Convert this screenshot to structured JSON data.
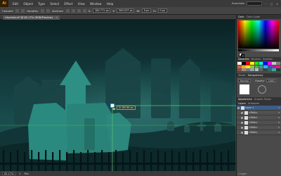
{
  "menubar": {
    "app_logo": "Ai",
    "items": [
      "Edit",
      "Object",
      "Type",
      "Select",
      "Effect",
      "View",
      "Window",
      "Help"
    ],
    "workspace": "Essentials",
    "window_controls": [
      "–",
      "□",
      "✕"
    ]
  },
  "controlbar": {
    "convert_label": "Convert:",
    "handles_label": "Handles:",
    "anchors_label": "Anchors:",
    "x_label": "X:",
    "x_value": "182.771 px",
    "y_label": "Y:",
    "y_value": "363.237 px",
    "w_label": "W:",
    "w_value": "0 px",
    "h_label": "H:",
    "h_value": "0 px"
  },
  "document_tab": {
    "label": "Haunted.ai* @ 65.17% (RGB/Preview)",
    "close": "✕"
  },
  "canvas": {
    "measure_tooltip": "D: 89.90 px"
  },
  "statusbar": {
    "zoom": "65.17%",
    "page": "1",
    "tool": "Pen",
    "accent_color": "#5ec463"
  },
  "panels": {
    "color_tabs": [
      "Color",
      "Color Guide"
    ],
    "swatch_tabs": [
      "Swatches",
      "Brushes",
      "Symbols"
    ],
    "swatches": [
      "#ffffff",
      "#000000",
      "#ff0000",
      "#ffff00",
      "#00ff00",
      "#00ffff",
      "#0000ff",
      "#ff00ff",
      "#c8c8c8",
      "#7f7f7f",
      "#e8563f",
      "#f5a623",
      "#f8e71c",
      "#8bc34a",
      "#4caf50",
      "#26a69a",
      "#29b6f6",
      "#3f51b5",
      "#9c27b0",
      "#e91e63",
      "#795548",
      "#a1887f",
      "#607d8b",
      "#90a4ae",
      "#bdbdbd",
      "#616161",
      "#424242",
      "#2c6e63",
      "#3aa89c",
      "#1a3d3f"
    ],
    "stroke_tabs": [
      "Stroke",
      "Transparency"
    ],
    "blend_mode": "Normal",
    "opacity_label": "Opacity:",
    "opacity_value": "100%",
    "appearance_tabs": [
      "Appearance",
      "Graphic Styles"
    ],
    "layers_tabs": [
      "Layers",
      "Artboards"
    ],
    "layers": [
      {
        "name": "Layer 1"
      },
      {
        "name": "<Path>"
      },
      {
        "name": "<Path>"
      },
      {
        "name": "<Path>"
      },
      {
        "name": "<Path>"
      },
      {
        "name": "<Path>"
      }
    ],
    "layers_count": "1 Layer"
  }
}
